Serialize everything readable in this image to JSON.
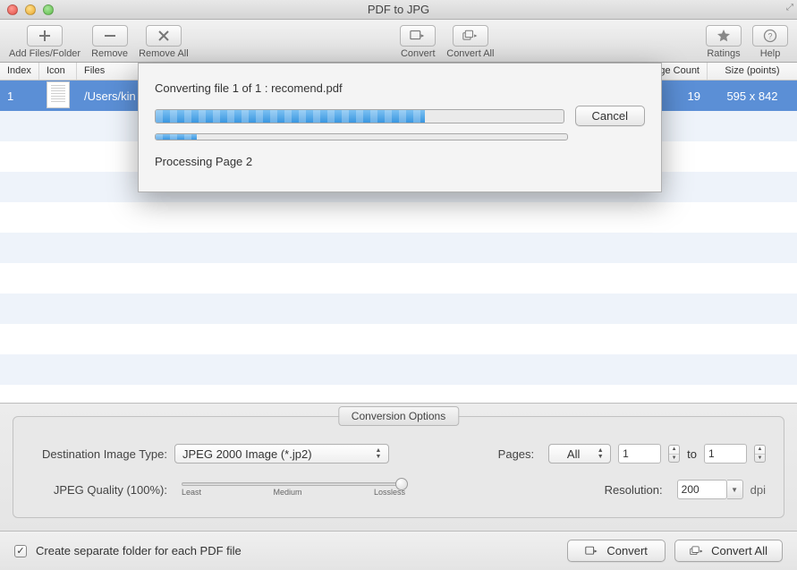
{
  "window": {
    "title": "PDF to JPG"
  },
  "toolbar": {
    "add": "Add Files/Folder",
    "remove": "Remove",
    "remove_all": "Remove All",
    "convert": "Convert",
    "convert_all": "Convert All",
    "ratings": "Ratings",
    "help": "Help"
  },
  "columns": {
    "index": "Index",
    "icon": "Icon",
    "files": "Files",
    "page_count": "ge Count",
    "size": "Size (points)"
  },
  "rows": [
    {
      "index": "1",
      "path": "/Users/kin",
      "page_count": "19",
      "size": "595 x 842"
    }
  ],
  "dialog": {
    "title": "Converting file 1 of 1 : recomend.pdf",
    "cancel": "Cancel",
    "processing": "Processing Page 2",
    "main_progress_pct": 66,
    "sub_progress_pct": 10
  },
  "options": {
    "frame_label": "Conversion Options",
    "dest_label": "Destination Image Type:",
    "dest_value": "JPEG 2000 Image (*.jp2)",
    "quality_label": "JPEG Quality (100%):",
    "slider_least": "Least",
    "slider_medium": "Medium",
    "slider_lossless": "Lossless",
    "pages_label": "Pages:",
    "pages_mode": "All",
    "pages_from": "1",
    "pages_to_label": "to",
    "pages_to": "1",
    "res_label": "Resolution:",
    "res_value": "200",
    "res_unit": "dpi"
  },
  "footer": {
    "checkbox_label": "Create separate folder for each PDF file",
    "checked": true,
    "convert": "Convert",
    "convert_all": "Convert All"
  }
}
